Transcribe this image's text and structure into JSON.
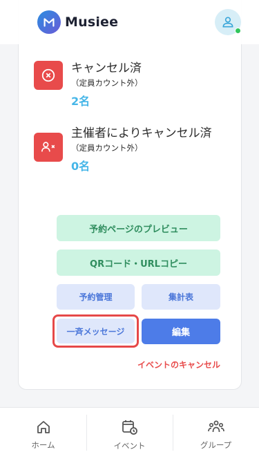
{
  "header": {
    "app_name": "Musiee",
    "logo_letter": "M",
    "avatar_icon": "user-icon",
    "online_status_color": "#30c55b"
  },
  "rows": [
    {
      "title": "キャンセル済",
      "subtitle": "（定員カウント外）",
      "count": "2名",
      "icon": "x-circle-icon"
    },
    {
      "title": "主催者によりキャンセル済",
      "subtitle": "（定員カウント外）",
      "count": "0名",
      "icon": "user-remove-icon"
    }
  ],
  "actions": {
    "preview_label": "予約ページのプレビュー",
    "qr_url_label": "QRコード・URLコピー",
    "reservation_mgmt_label": "予約管理",
    "summary_label": "集計表",
    "bulk_message_label": "一斉メッセージ",
    "edit_label": "編集",
    "cancel_event_label": "イベントのキャンセル"
  },
  "nav": [
    {
      "label": "ホーム",
      "icon": "home-icon"
    },
    {
      "label": "イベント",
      "icon": "calendar-clock-icon"
    },
    {
      "label": "グループ",
      "icon": "group-icon"
    }
  ],
  "colors": {
    "danger": "#e84b4b",
    "count": "#46b6e8",
    "primary": "#4d7ce8",
    "green_bg": "#cdf4e2",
    "light_blue_bg": "#dfe7fb"
  }
}
